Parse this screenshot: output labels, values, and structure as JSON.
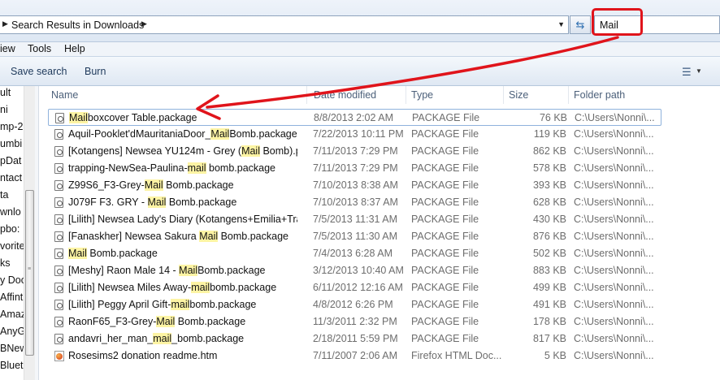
{
  "address": {
    "path": "Search Results in Downloads",
    "search_value": "Mail"
  },
  "menu": [
    "iew",
    "Tools",
    "Help"
  ],
  "toolbar": {
    "save_search": "Save search",
    "burn": "Burn"
  },
  "nav": {
    "items": [
      "ult",
      "ni",
      "mp-2",
      "umbi",
      "pDat",
      "ntact",
      "ta",
      "wnlo",
      "pbo:",
      "vorite",
      "ks",
      "y Doc",
      "Affint",
      "Amaz",
      "AnyGa",
      "BNew",
      "Blueto"
    ]
  },
  "columns": {
    "name": "Name",
    "date": "Date modified",
    "type": "Type",
    "size": "Size",
    "path": "Folder path"
  },
  "files": [
    {
      "pre": "",
      "hl": "Mail",
      "post": "boxcover Table.package",
      "date": "8/8/2013 2:02 AM",
      "type": "PACKAGE File",
      "size": "76 KB",
      "path": "C:\\Users\\Nonni\\..."
    },
    {
      "pre": "Aquil-Pooklet'dMauritaniaDoor_",
      "hl": "Mail",
      "post": "Bomb.package",
      "date": "7/22/2013 10:11 PM",
      "type": "PACKAGE File",
      "size": "119 KB",
      "path": "C:\\Users\\Nonni\\..."
    },
    {
      "pre": "[Kotangens] Newsea YU124m - Grey (",
      "hl": "Mail",
      "post": " Bomb).pa...",
      "date": "7/11/2013 7:29 PM",
      "type": "PACKAGE File",
      "size": "862 KB",
      "path": "C:\\Users\\Nonni\\..."
    },
    {
      "pre": "trapping-NewSea-Paulina-",
      "hl": "mail",
      "post": " bomb.package",
      "date": "7/11/2013 7:29 PM",
      "type": "PACKAGE File",
      "size": "578 KB",
      "path": "C:\\Users\\Nonni\\..."
    },
    {
      "pre": "Z99S6_F3-Grey-",
      "hl": "Mail",
      "post": " Bomb.package",
      "date": "7/10/2013 8:38 AM",
      "type": "PACKAGE File",
      "size": "393 KB",
      "path": "C:\\Users\\Nonni\\..."
    },
    {
      "pre": "J079F F3. GRY - ",
      "hl": "Mail",
      "post": " Bomb.package",
      "date": "7/10/2013 8:37 AM",
      "type": "PACKAGE File",
      "size": "628 KB",
      "path": "C:\\Users\\Nonni\\..."
    },
    {
      "pre": "[Lilith] Newsea Lady's Diary (Kotangens+Emilia+Trap...",
      "hl": "",
      "post": "",
      "date": "7/5/2013 11:31 AM",
      "type": "PACKAGE File",
      "size": "430 KB",
      "path": "C:\\Users\\Nonni\\..."
    },
    {
      "pre": "[Fanaskher] Newsea Sakura ",
      "hl": "Mail",
      "post": " Bomb.package",
      "date": "7/5/2013 11:30 AM",
      "type": "PACKAGE File",
      "size": "876 KB",
      "path": "C:\\Users\\Nonni\\..."
    },
    {
      "pre": "",
      "hl": "Mail",
      "post": " Bomb.package",
      "date": "7/4/2013 6:28 AM",
      "type": "PACKAGE File",
      "size": "502 KB",
      "path": "C:\\Users\\Nonni\\..."
    },
    {
      "pre": "[Meshy] Raon Male 14 - ",
      "hl": "Mail",
      "post": "Bomb.package",
      "date": "3/12/2013 10:40 AM",
      "type": "PACKAGE File",
      "size": "883 KB",
      "path": "C:\\Users\\Nonni\\..."
    },
    {
      "pre": "[Lilith] Newsea Miles Away-",
      "hl": "mail",
      "post": "bomb.package",
      "date": "6/11/2012 12:16 AM",
      "type": "PACKAGE File",
      "size": "499 KB",
      "path": "C:\\Users\\Nonni\\..."
    },
    {
      "pre": "[Lilith] Peggy April Gift-",
      "hl": "mail",
      "post": "bomb.package",
      "date": "4/8/2012 6:26 PM",
      "type": "PACKAGE File",
      "size": "491 KB",
      "path": "C:\\Users\\Nonni\\..."
    },
    {
      "pre": "RaonF65_F3-Grey-",
      "hl": "Mail",
      "post": " Bomb.package",
      "date": "11/3/2011 2:32 PM",
      "type": "PACKAGE File",
      "size": "178 KB",
      "path": "C:\\Users\\Nonni\\..."
    },
    {
      "pre": "andavri_her_man_",
      "hl": "mail",
      "post": "_bomb.package",
      "date": "2/18/2011 5:59 PM",
      "type": "PACKAGE File",
      "size": "817 KB",
      "path": "C:\\Users\\Nonni\\..."
    },
    {
      "pre": "Rosesims2 donation readme.htm",
      "hl": "",
      "post": "",
      "date": "7/11/2007 2:06 AM",
      "type": "Firefox HTML Doc...",
      "size": "5 KB",
      "path": "C:\\Users\\Nonni\\..."
    }
  ],
  "colors": {
    "highlight": "#fdf4a4",
    "annotation": "#e0141b",
    "selection_border": "#8fb2dc"
  }
}
